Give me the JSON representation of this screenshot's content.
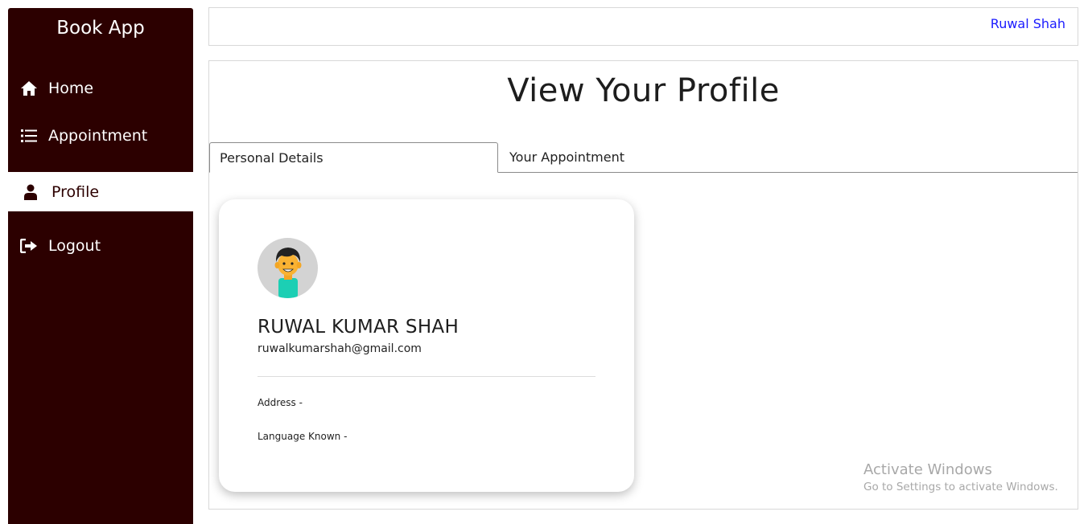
{
  "sidebar": {
    "brand": "Book App",
    "items": [
      {
        "label": "Home",
        "icon": "home-icon"
      },
      {
        "label": "Appointment",
        "icon": "list-icon"
      },
      {
        "label": "Profile",
        "icon": "user-icon",
        "active": true
      },
      {
        "label": "Logout",
        "icon": "logout-icon"
      }
    ]
  },
  "header": {
    "user_name": "Ruwal Shah"
  },
  "main": {
    "title": "View Your Profile",
    "tabs": [
      {
        "label": "Personal Details",
        "active": true
      },
      {
        "label": "Your Appointment",
        "active": false
      }
    ],
    "profile": {
      "name": "RUWAL KUMAR SHAH",
      "email": "ruwalkumarshah@gmail.com",
      "address_label": "Address -",
      "language_label": "Language Known -"
    }
  },
  "watermark": {
    "line1": "Activate Windows",
    "line2": "Go to Settings to activate Windows."
  },
  "colors": {
    "sidebar_bg": "#2c0000",
    "link": "#1a1aff",
    "avatar_bg": "#d3d3d3",
    "avatar_shirt": "#1ccfb4",
    "avatar_skin": "#f9b233"
  }
}
